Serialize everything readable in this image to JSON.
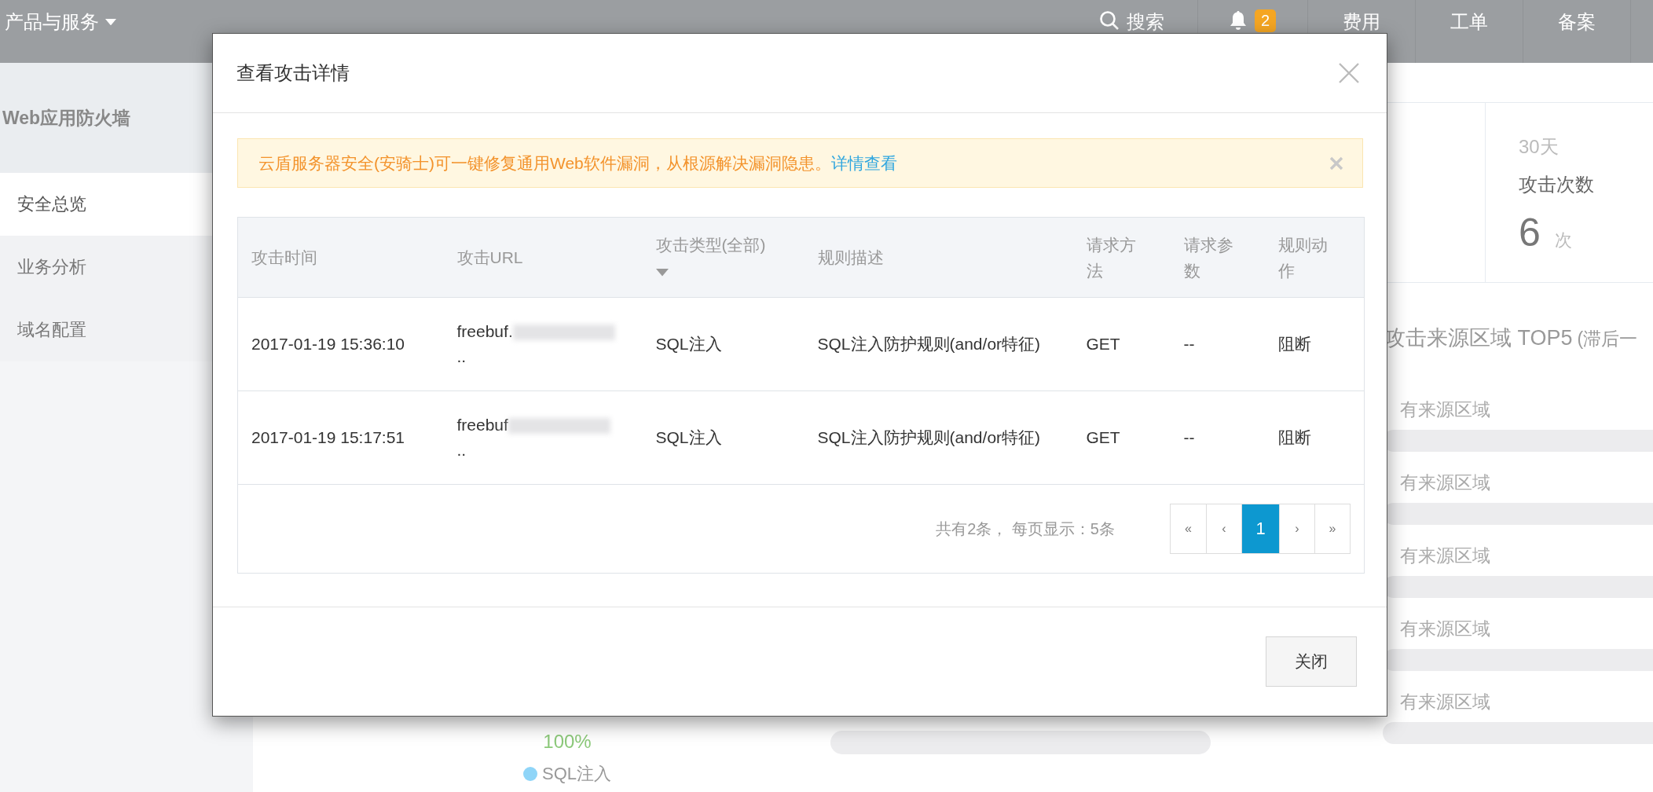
{
  "topbar": {
    "menu": "产品与服务",
    "search": "搜索",
    "notification_count": "2",
    "links": [
      "费用",
      "工单",
      "备案"
    ]
  },
  "sidebar": {
    "title": "Web应用防火墙",
    "items": [
      {
        "label": "安全总览",
        "selected": true
      },
      {
        "label": "业务分析",
        "selected": false
      },
      {
        "label": "域名配置",
        "selected": false
      }
    ]
  },
  "overview": {
    "stat": {
      "period": "30天",
      "label": "攻击次数",
      "value": "6",
      "unit": "次"
    },
    "region_title": "攻击来源区域 TOP5",
    "region_note": "(滞后一",
    "regions": [
      "有来源区域",
      "有来源区域",
      "有来源区域",
      "有来源区域",
      "有来源区域"
    ],
    "share": {
      "percent": "100%",
      "legend": "SQL注入",
      "color": "#8fd5f8"
    }
  },
  "modal": {
    "title": "查看攻击详情",
    "alert": {
      "text": "云盾服务器安全(安骑士)可一键修复通用Web软件漏洞，从根源解决漏洞隐患。",
      "link": "详情查看"
    },
    "columns": [
      {
        "label": "攻击时间",
        "sortable": false
      },
      {
        "label": "攻击URL",
        "sortable": false
      },
      {
        "label": "攻击类型(全部)",
        "sortable": true
      },
      {
        "label": "规则描述",
        "sortable": false
      },
      {
        "label": "请求方法",
        "sortable": false
      },
      {
        "label": "请求参数",
        "sortable": false
      },
      {
        "label": "规则动作",
        "sortable": false
      }
    ],
    "rows": [
      {
        "time": "2017-01-19 15:36:10",
        "url_host": "freebuf.",
        "url_tail": "..",
        "type": "SQL注入",
        "rule": "SQL注入防护规则(and/or特征)",
        "method": "GET",
        "params": "--",
        "action": "阻断"
      },
      {
        "time": "2017-01-19 15:17:51",
        "url_host": "freebuf",
        "url_tail": "..",
        "type": "SQL注入",
        "rule": "SQL注入防护规则(and/or特征)",
        "method": "GET",
        "params": "--",
        "action": "阻断"
      }
    ],
    "pagination": {
      "summary": "共有2条， 每页显示：5条",
      "pages": [
        {
          "label": "«",
          "selected": false
        },
        {
          "label": "‹",
          "selected": false
        },
        {
          "label": "1",
          "selected": true
        },
        {
          "label": "›",
          "selected": false
        },
        {
          "label": "»",
          "selected": false
        }
      ]
    },
    "close_button": "关闭"
  }
}
